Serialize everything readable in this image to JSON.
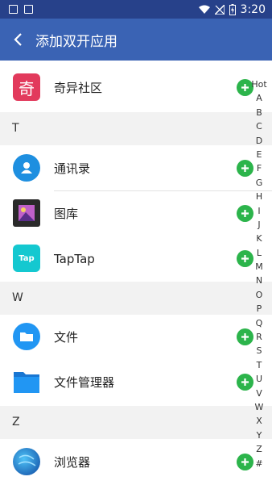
{
  "status_bar": {
    "time": "3:20"
  },
  "app_bar": {
    "title": "添加双开应用"
  },
  "colors": {
    "app_bar": "#3a63b4",
    "status_bar": "#27418a",
    "add_button": "#2cb44b"
  },
  "list": {
    "top_item": {
      "label": "奇异社区",
      "icon_text": "奇",
      "icon": "qiyi-community-icon"
    },
    "section_t": "T",
    "t_items": [
      {
        "label": "通讯录",
        "icon": "contacts-icon"
      },
      {
        "label": "图库",
        "icon": "gallery-icon"
      },
      {
        "label": "TapTap",
        "icon_text": "Tap",
        "icon": "taptap-icon"
      }
    ],
    "section_w": "W",
    "w_items": [
      {
        "label": "文件",
        "icon": "files-icon"
      },
      {
        "label": "文件管理器",
        "icon": "file-manager-icon"
      }
    ],
    "section_z": "Z",
    "z_items": [
      {
        "label": "浏览器",
        "icon": "browser-icon"
      }
    ]
  },
  "index_bar": [
    "Hot",
    "A",
    "B",
    "C",
    "D",
    "E",
    "F",
    "G",
    "H",
    "I",
    "J",
    "K",
    "L",
    "M",
    "N",
    "O",
    "P",
    "Q",
    "R",
    "S",
    "T",
    "U",
    "V",
    "W",
    "X",
    "Y",
    "Z",
    "#"
  ]
}
